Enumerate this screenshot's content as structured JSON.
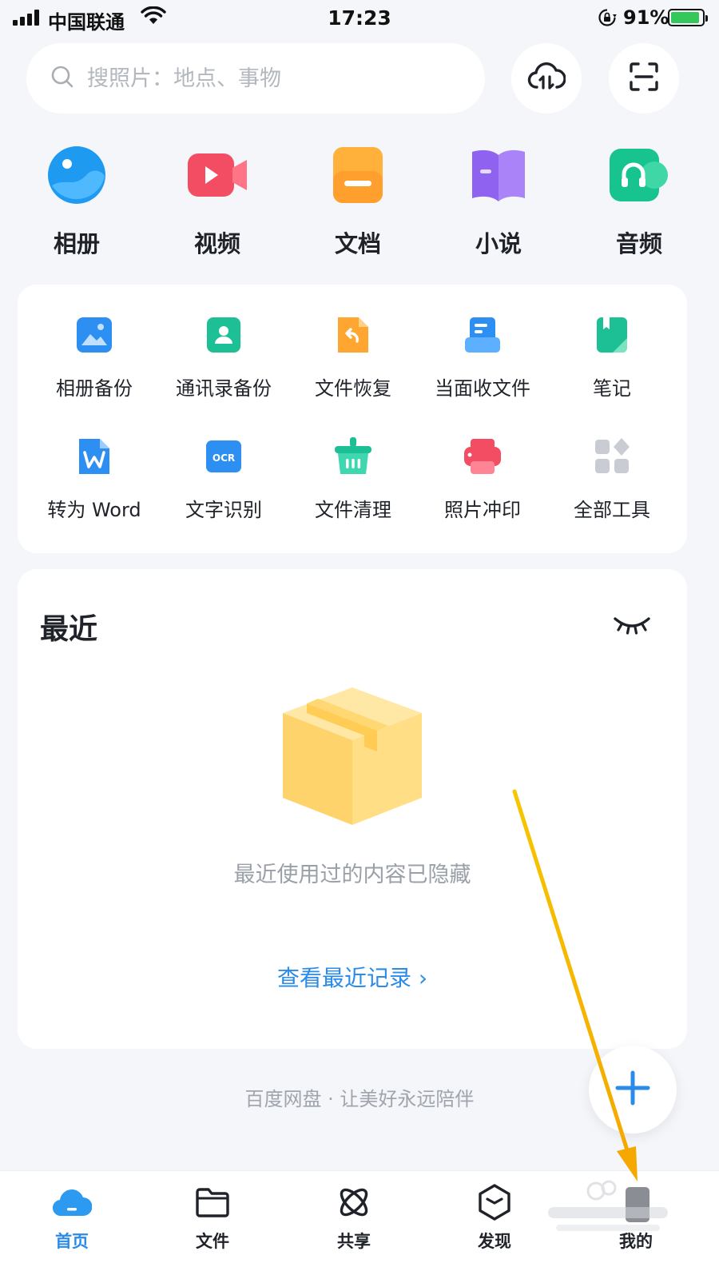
{
  "status_bar": {
    "carrier": "中国联通",
    "time": "17:23",
    "battery_percent": "91%",
    "battery_level": 0.91,
    "icons": [
      "signal-icon",
      "wifi-icon",
      "orientation-lock-icon",
      "battery-charging-icon"
    ]
  },
  "search": {
    "placeholder": "搜照片：地点、事物",
    "icon": "search-icon"
  },
  "top_buttons": [
    {
      "icon": "cloud-upload-icon"
    },
    {
      "icon": "scan-icon"
    }
  ],
  "categories": [
    {
      "label": "相册",
      "icon": "album-icon",
      "color": "#1e9af0"
    },
    {
      "label": "视频",
      "icon": "video-icon",
      "color": "#f34d63"
    },
    {
      "label": "文档",
      "icon": "document-icon",
      "color": "#ff9f2e"
    },
    {
      "label": "小说",
      "icon": "novel-icon",
      "color": "#8f63f0"
    },
    {
      "label": "音频",
      "icon": "audio-icon",
      "color": "#17c38f"
    }
  ],
  "tools": [
    {
      "label": "相册备份",
      "icon": "photo-backup-icon"
    },
    {
      "label": "通讯录备份",
      "icon": "contacts-backup-icon"
    },
    {
      "label": "文件恢复",
      "icon": "file-restore-icon"
    },
    {
      "label": "当面收文件",
      "icon": "receive-file-icon"
    },
    {
      "label": "笔记",
      "icon": "notes-icon"
    },
    {
      "label": "转为 Word",
      "icon": "word-convert-icon"
    },
    {
      "label": "文字识别",
      "icon": "ocr-icon"
    },
    {
      "label": "文件清理",
      "icon": "file-clean-icon"
    },
    {
      "label": "照片冲印",
      "icon": "photo-print-icon"
    },
    {
      "label": "全部工具",
      "icon": "all-tools-icon"
    }
  ],
  "ocr_badge": "OCR",
  "recent": {
    "title": "最近",
    "empty_message": "最近使用过的内容已隐藏",
    "link": "查看最近记录 ›"
  },
  "slogan": "百度网盘 · 让美好永远陪伴",
  "tabs": [
    {
      "label": "首页",
      "icon": "home-cloud-icon",
      "active": true
    },
    {
      "label": "文件",
      "icon": "folder-icon",
      "active": false
    },
    {
      "label": "共享",
      "icon": "share-atom-icon",
      "active": false
    },
    {
      "label": "发现",
      "icon": "discover-icon",
      "active": false
    },
    {
      "label": "我的",
      "icon": "profile-icon",
      "active": false
    }
  ],
  "colors": {
    "accent": "#2b8be8",
    "background": "#f4f6fa",
    "annotation_arrow": "#f5b400"
  }
}
